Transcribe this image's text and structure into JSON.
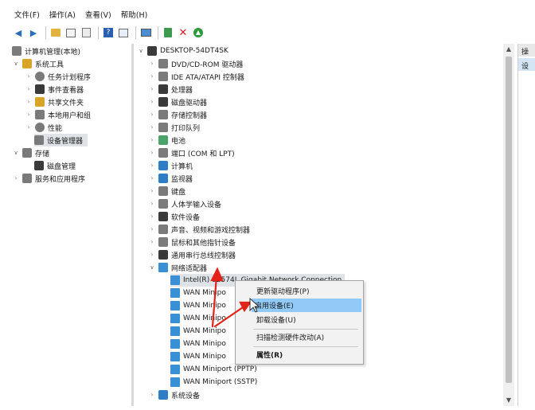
{
  "menu": [
    "文件(F)",
    "操作(A)",
    "查看(V)",
    "帮助(H)"
  ],
  "toolbar": {
    "icons": [
      "back-icon",
      "forward-icon",
      "up-folder-icon",
      "show-hide-tree-icon",
      "properties-icon",
      "help-icon",
      "view-icon",
      "monitor-icon",
      "update-driver-icon",
      "uninstall-icon",
      "enable-icon"
    ],
    "uninstall_glyph": "✕"
  },
  "left_tree": [
    "计算机管理(本地)",
    "系统工具",
    "任务计划程序",
    "事件查看器",
    "共享文件夹",
    "本地用户和组",
    "性能",
    "设备管理器",
    "存储",
    "磁盘管理",
    "服务和应用程序"
  ],
  "device_tree": {
    "root": "DESKTOP-54DT4SK",
    "categories": [
      "DVD/CD-ROM 驱动器",
      "IDE ATA/ATAPI 控制器",
      "处理器",
      "磁盘驱动器",
      "存储控制器",
      "打印队列",
      "电池",
      "端口 (COM 和 LPT)",
      "计算机",
      "监视器",
      "键盘",
      "人体学输入设备",
      "软件设备",
      "声音、视频和游戏控制器",
      "鼠标和其他指针设备",
      "通用串行总线控制器",
      "网络适配器"
    ],
    "network_children": [
      "Intel(R) 82574L Gigabit Network Connection",
      "WAN Minipo",
      "WAN Minipo",
      "WAN Minipo",
      "WAN Minipo",
      "WAN Minipo",
      "WAN Minipo",
      "WAN Miniport (PPTP)",
      "WAN Miniport (SSTP)"
    ],
    "after": "系统设备"
  },
  "context_menu": {
    "update_driver": "更新驱动程序(P)",
    "enable_device": "启用设备(E)",
    "uninstall_device": "卸载设备(U)",
    "scan_hardware": "扫描检测硬件改动(A)",
    "properties": "属性(R)"
  },
  "right_pane": {
    "header": "操",
    "sub": "设"
  },
  "colors": {
    "highlight": "#91c9f7",
    "annotation": "#e32219",
    "uninstall": "#d61f1f",
    "enable": "#2b9a3a"
  }
}
